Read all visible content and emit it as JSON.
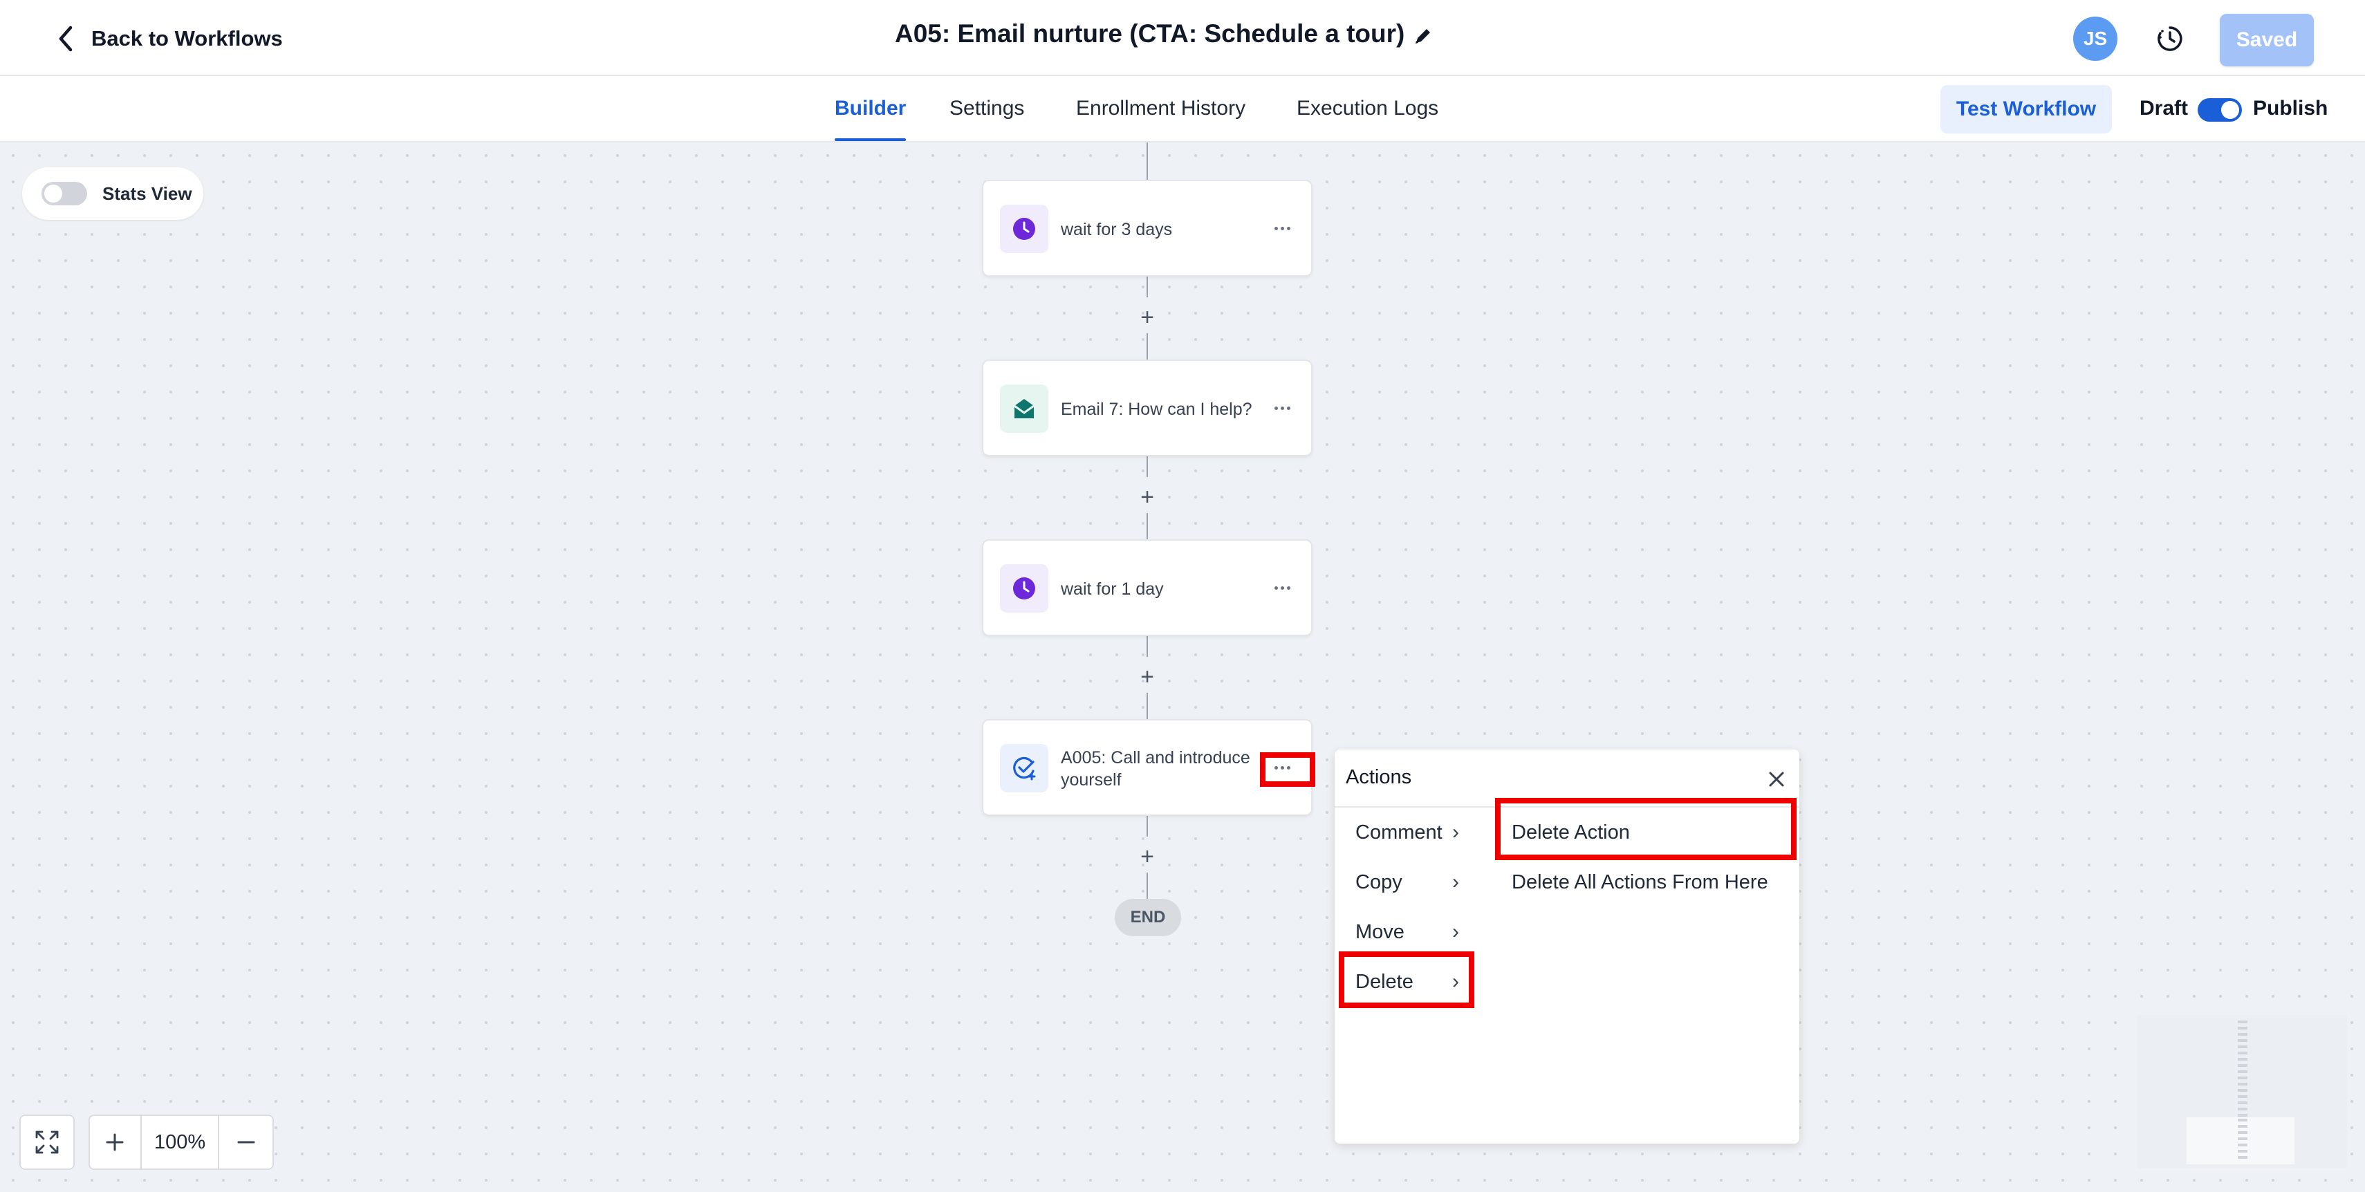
{
  "header": {
    "back_label": "Back to Workflows",
    "title": "A05: Email nurture (CTA: Schedule a tour)",
    "avatar_initials": "JS",
    "saved_label": "Saved"
  },
  "tabs": [
    {
      "label": "Builder",
      "active": true
    },
    {
      "label": "Settings",
      "active": false
    },
    {
      "label": "Enrollment History",
      "active": false
    },
    {
      "label": "Execution Logs",
      "active": false
    }
  ],
  "toolbar": {
    "test_label": "Test Workflow",
    "draft_label": "Draft",
    "publish_label": "Publish",
    "publish_toggle_on": true
  },
  "canvas": {
    "stats_label": "Stats View",
    "stats_toggle_on": false,
    "end_label": "END",
    "zoom_level": "100%"
  },
  "nodes": [
    {
      "label": "wait for 3 days",
      "icon": "clock-icon",
      "color": "#6d28d9"
    },
    {
      "label": "Email 7: How can I help?",
      "icon": "email-icon",
      "color": "#0f766e"
    },
    {
      "label": "wait for 1 day",
      "icon": "clock-icon",
      "color": "#6d28d9"
    },
    {
      "label": "A005: Call and introduce yourself",
      "icon": "task-check-icon",
      "color": "#1a5fd8"
    }
  ],
  "actions_menu": {
    "title": "Actions",
    "items": [
      "Comment",
      "Copy",
      "Move",
      "Delete"
    ],
    "delete_submenu": [
      "Delete Action",
      "Delete All Actions From Here"
    ]
  },
  "colors": {
    "accent": "#1a5fd8",
    "highlight": "#ee0000",
    "saved_button": "#a3c2f7"
  }
}
